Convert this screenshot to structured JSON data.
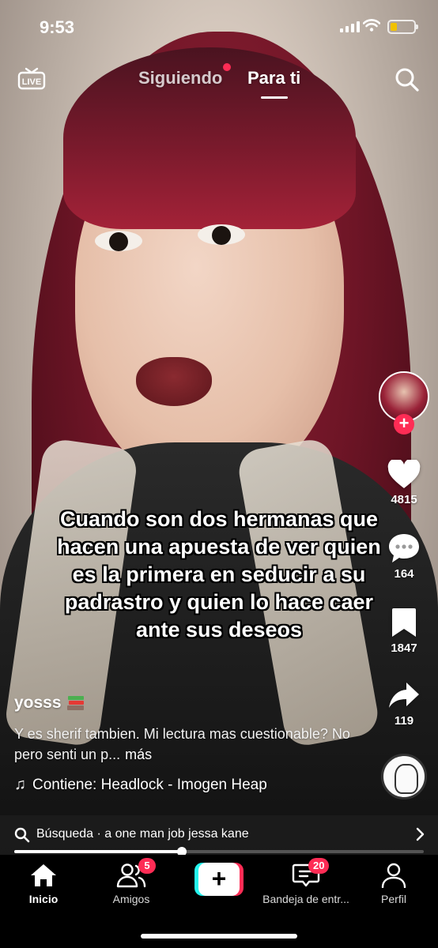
{
  "status_bar": {
    "time": "9:53"
  },
  "top_nav": {
    "live_label": "LIVE",
    "tabs": [
      {
        "label": "Siguiendo",
        "active": false,
        "has_dot": true
      },
      {
        "label": "Para ti",
        "active": true
      }
    ]
  },
  "video": {
    "caption": "Cuando son dos  hermanas que hacen una apuesta de ver quien es la primera en seducir a su padrastro y quien lo hace caer ante sus deseos"
  },
  "author": {
    "username": "yosss",
    "description": "Y es sherif  tambien.     Mi lectura mas cuestionable? No pero senti un p...",
    "more_label": "más",
    "music": "Contiene: Headlock - Imogen Heap"
  },
  "actions": {
    "follow_symbol": "+",
    "likes": "4815",
    "comments": "164",
    "saves": "1847",
    "shares": "119"
  },
  "search_bar": {
    "text": "Búsqueda · a one man job jessa kane"
  },
  "playback": {
    "progress": 0.41
  },
  "bottom_nav": {
    "items": [
      {
        "label": "Inicio",
        "active": true
      },
      {
        "label": "Amigos",
        "badge": "5"
      },
      {
        "label": "",
        "create": "+"
      },
      {
        "label": "Bandeja de entr...",
        "badge": "20"
      },
      {
        "label": "Perfil"
      }
    ]
  },
  "colors": {
    "accent": "#fe2c55",
    "cyan": "#25f4ee",
    "battery": "#f2c200"
  },
  "icons": [
    "live-icon",
    "search-icon",
    "heart-icon",
    "comment-icon",
    "bookmark-icon",
    "share-icon",
    "music-note-icon",
    "home-icon",
    "friends-icon",
    "inbox-icon",
    "profile-icon",
    "chevron-right-icon"
  ]
}
